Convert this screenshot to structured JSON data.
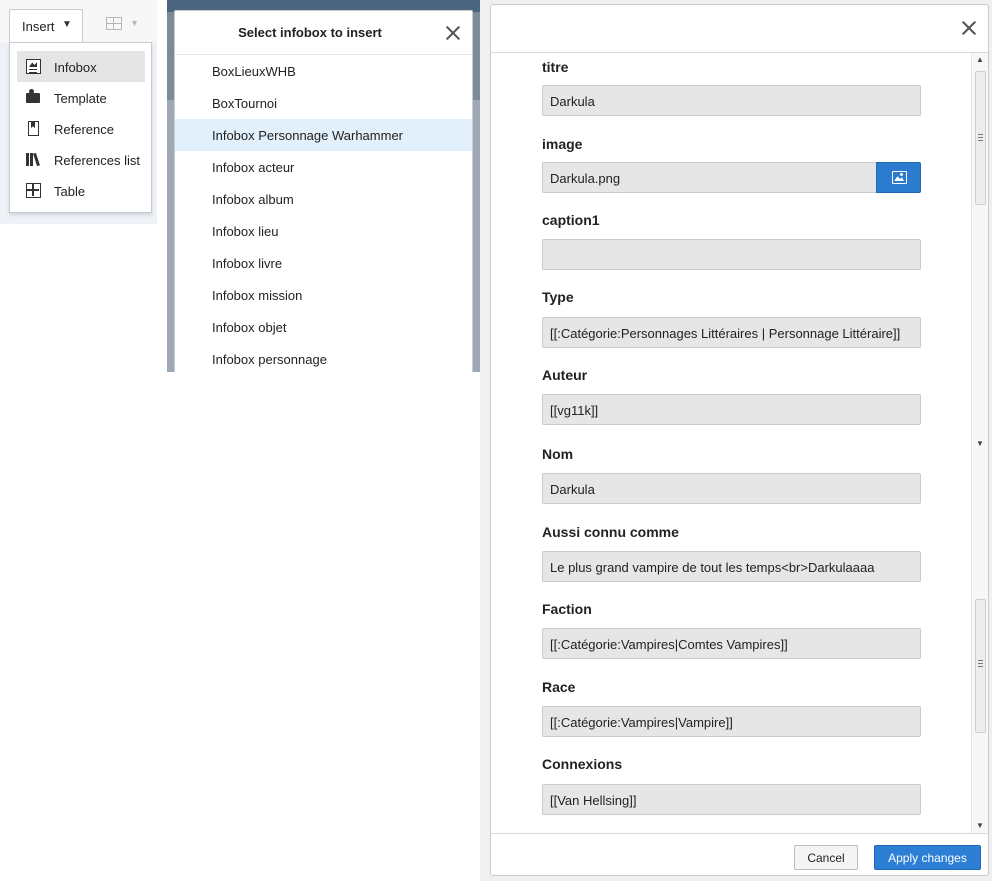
{
  "insert_menu": {
    "button_label": "Insert",
    "items": [
      {
        "label": "Infobox",
        "icon": "infobox-icon",
        "selected": true
      },
      {
        "label": "Template",
        "icon": "puzzle-piece-icon",
        "selected": false
      },
      {
        "label": "Reference",
        "icon": "bookmark-icon",
        "selected": false
      },
      {
        "label": "References list",
        "icon": "books-icon",
        "selected": false
      },
      {
        "label": "Table",
        "icon": "table-icon",
        "selected": false
      }
    ]
  },
  "select_dialog": {
    "title": "Select infobox to insert",
    "options": [
      {
        "label": "BoxLieuxWHB",
        "highlighted": false
      },
      {
        "label": "BoxTournoi",
        "highlighted": false
      },
      {
        "label": "Infobox Personnage Warhammer",
        "highlighted": true
      },
      {
        "label": "Infobox acteur",
        "highlighted": false
      },
      {
        "label": "Infobox album",
        "highlighted": false
      },
      {
        "label": "Infobox lieu",
        "highlighted": false
      },
      {
        "label": "Infobox livre",
        "highlighted": false
      },
      {
        "label": "Infobox mission",
        "highlighted": false
      },
      {
        "label": "Infobox objet",
        "highlighted": false
      },
      {
        "label": "Infobox personnage",
        "highlighted": false
      }
    ]
  },
  "editor_dialog": {
    "fields": [
      {
        "label": "titre",
        "value": "Darkula"
      },
      {
        "label": "image",
        "value": "Darkula.png"
      },
      {
        "label": "caption1",
        "value": ""
      },
      {
        "label": "Type",
        "value": "[[:Catégorie:Personnages Littéraires | Personnage Littéraire]]"
      },
      {
        "label": "Auteur",
        "value": "[[vg11k]]"
      },
      {
        "label": "Nom",
        "value": "Darkula"
      },
      {
        "label": "Aussi connu comme",
        "value": "Le plus grand vampire de tout les temps<br>Darkulaaaa"
      },
      {
        "label": "Faction",
        "value": "[[:Catégorie:Vampires|Comtes Vampires]]"
      },
      {
        "label": "Race",
        "value": "[[:Catégorie:Vampires|Vampire]]"
      },
      {
        "label": "Connexions",
        "value": "[[Van Hellsing]]"
      }
    ],
    "cancel_label": "Cancel",
    "apply_label": "Apply changes"
  },
  "colors": {
    "primary_button": "#2d7fd6",
    "highlight_row": "#e1f0fb",
    "selected_menu_item": "#e5e5e5",
    "field_background": "#e6e6e6"
  }
}
